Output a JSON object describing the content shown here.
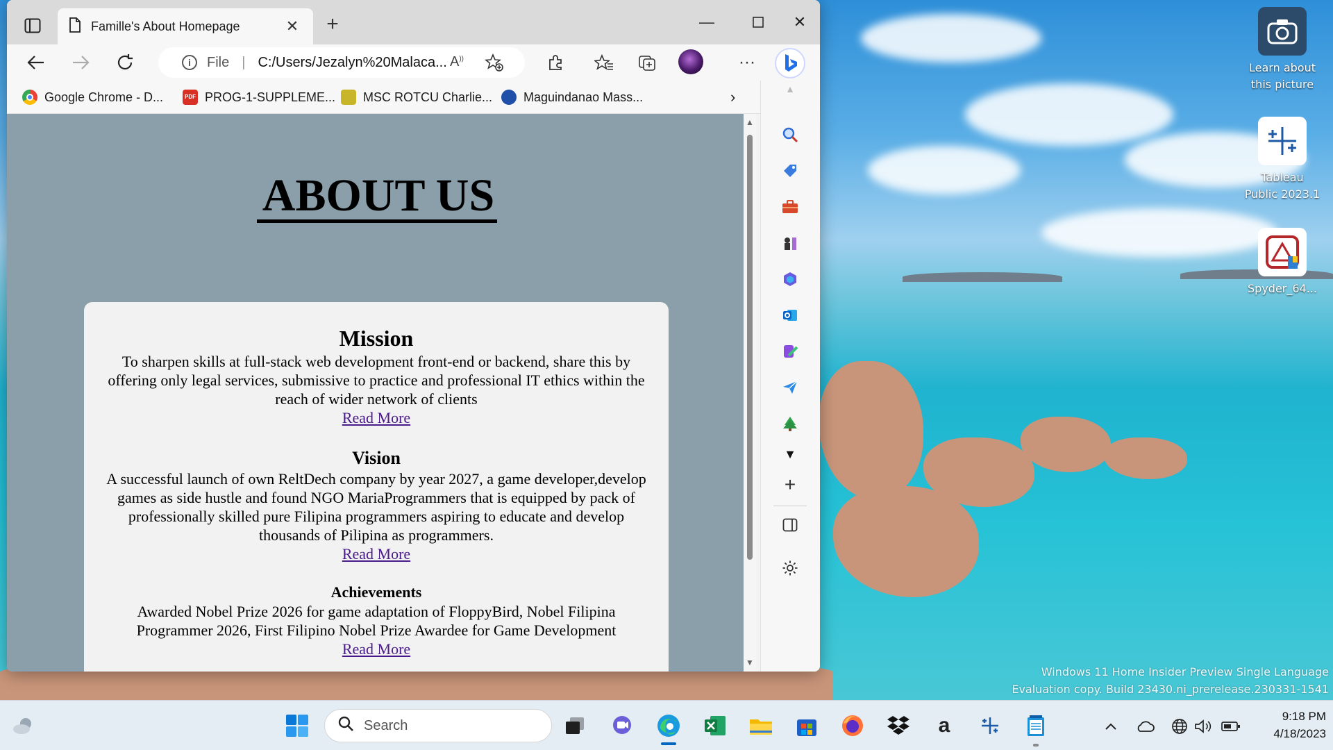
{
  "browser": {
    "tab_title": "Famille's About Homepage",
    "address": {
      "scheme": "File",
      "url": "C:/Users/Jezalyn%20Malaca..."
    },
    "favorites": [
      {
        "label": "Google Chrome - D...",
        "icon": "chrome-icon"
      },
      {
        "label": "PROG-1-SUPPLEME...",
        "icon": "pdf-icon"
      },
      {
        "label": "MSC ROTCU Charlie...",
        "icon": "image-icon"
      },
      {
        "label": "Maguindanao Mass...",
        "icon": "site-icon"
      }
    ]
  },
  "page": {
    "heading": "ABOUT US",
    "sections": [
      {
        "title": "Mission",
        "text": "To sharpen skills at full-stack web development front-end or backend, share this by offering only legal services, submissive to practice and professional IT ethics within the reach of wider network of clients",
        "link": "Read More"
      },
      {
        "title": "Vision",
        "text": "A successful launch of own ReltDech company by year 2027, a game developer,develop games as side hustle and found NGO MariaProgrammers that is equipped by pack of professionally skilled pure Filipina programmers aspiring to educate and develop thousands of Pilipina as programmers.",
        "link": "Read More"
      },
      {
        "title": "Achievements",
        "text": "Awarded Nobel Prize 2026 for game adaptation of FloppyBird, Nobel Filipina Programmer 2026, First Filipino Nobel Prize Awardee for Game Development",
        "link": "Read More"
      }
    ]
  },
  "desktop": {
    "icons": [
      {
        "label_line1": "Learn about",
        "label_line2": "this picture"
      },
      {
        "label_line1": "Tableau",
        "label_line2": "Public 2023.1"
      },
      {
        "label_line1": "Spyder_64...",
        "label_line2": ""
      }
    ],
    "watermark_line1": "Windows 11 Home Insider Preview Single Language",
    "watermark_line2": "Evaluation copy. Build 23430.ni_prerelease.230331-1541"
  },
  "taskbar": {
    "search_placeholder": "Search",
    "time": "9:18 PM",
    "date": "4/18/2023"
  },
  "colors": {
    "page_bg": "#8a9fa9",
    "card_bg": "#f2f2f2",
    "link": "#4a1a8a",
    "accent": "#0067c0"
  }
}
